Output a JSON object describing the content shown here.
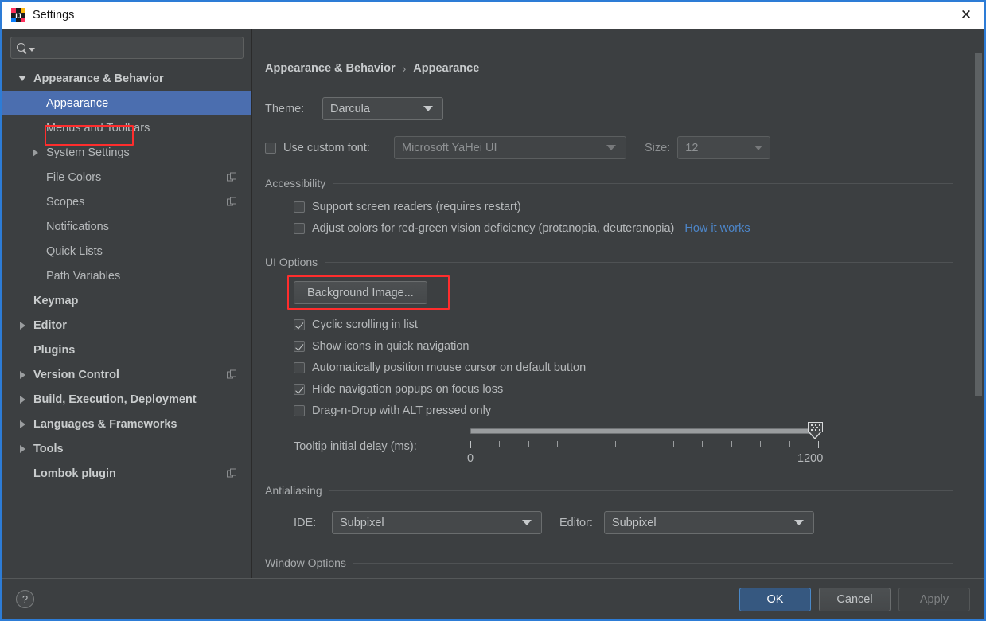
{
  "window": {
    "title": "Settings",
    "close_label": "✕",
    "accent_border": "#2d7cd6",
    "titlebar_bg": "#ffffff",
    "panel_bg": "#3c3f41",
    "selection_blue": "#4b6eaf",
    "link_blue": "#4d86c9",
    "annotation_red": "#ff2d2d"
  },
  "search": {
    "value": "",
    "placeholder": "",
    "icon": "search-icon",
    "dropdown_icon": "caret-down-icon"
  },
  "sidebar": {
    "items": [
      {
        "label": "Appearance & Behavior",
        "level": 0,
        "bold": true,
        "arrow": "down",
        "selected": false,
        "badge": false
      },
      {
        "label": "Appearance",
        "level": 1,
        "bold": false,
        "arrow": "none",
        "selected": true,
        "badge": false
      },
      {
        "label": "Menus and Toolbars",
        "level": 1,
        "bold": false,
        "arrow": "none",
        "selected": false,
        "badge": false
      },
      {
        "label": "System Settings",
        "level": 1,
        "bold": false,
        "arrow": "right",
        "selected": false,
        "badge": false
      },
      {
        "label": "File Colors",
        "level": 1,
        "bold": false,
        "arrow": "none",
        "selected": false,
        "badge": true
      },
      {
        "label": "Scopes",
        "level": 1,
        "bold": false,
        "arrow": "none",
        "selected": false,
        "badge": true
      },
      {
        "label": "Notifications",
        "level": 1,
        "bold": false,
        "arrow": "none",
        "selected": false,
        "badge": false
      },
      {
        "label": "Quick Lists",
        "level": 1,
        "bold": false,
        "arrow": "none",
        "selected": false,
        "badge": false
      },
      {
        "label": "Path Variables",
        "level": 1,
        "bold": false,
        "arrow": "none",
        "selected": false,
        "badge": false
      },
      {
        "label": "Keymap",
        "level": 0,
        "bold": true,
        "arrow": "none",
        "selected": false,
        "badge": false
      },
      {
        "label": "Editor",
        "level": 0,
        "bold": true,
        "arrow": "right",
        "selected": false,
        "badge": false
      },
      {
        "label": "Plugins",
        "level": 0,
        "bold": true,
        "arrow": "none",
        "selected": false,
        "badge": false
      },
      {
        "label": "Version Control",
        "level": 0,
        "bold": true,
        "arrow": "right",
        "selected": false,
        "badge": true
      },
      {
        "label": "Build, Execution, Deployment",
        "level": 0,
        "bold": true,
        "arrow": "right",
        "selected": false,
        "badge": false
      },
      {
        "label": "Languages & Frameworks",
        "level": 0,
        "bold": true,
        "arrow": "right",
        "selected": false,
        "badge": false
      },
      {
        "label": "Tools",
        "level": 0,
        "bold": true,
        "arrow": "right",
        "selected": false,
        "badge": false
      },
      {
        "label": "Lombok plugin",
        "level": 0,
        "bold": true,
        "arrow": "none",
        "selected": false,
        "badge": true
      }
    ]
  },
  "breadcrumb": {
    "parent": "Appearance & Behavior",
    "separator": "›",
    "current": "Appearance"
  },
  "theme": {
    "label": "Theme:",
    "value": "Darcula"
  },
  "custom_font": {
    "checkbox_label": "Use custom font:",
    "checked": false,
    "font_value": "Microsoft YaHei UI",
    "size_label": "Size:",
    "size_value": "12"
  },
  "accessibility": {
    "title": "Accessibility",
    "options": [
      {
        "label": "Support screen readers (requires restart)",
        "checked": false
      },
      {
        "label": "Adjust colors for red-green vision deficiency (protanopia, deuteranopia)",
        "checked": false
      }
    ],
    "link": "How it works"
  },
  "ui_options": {
    "title": "UI Options",
    "background_image_button": "Background Image...",
    "options": [
      {
        "label": "Cyclic scrolling in list",
        "checked": true
      },
      {
        "label": "Show icons in quick navigation",
        "checked": true
      },
      {
        "label": "Automatically position mouse cursor on default button",
        "checked": false
      },
      {
        "label": "Hide navigation popups on focus loss",
        "checked": true
      },
      {
        "label": "Drag-n-Drop with ALT pressed only",
        "checked": false
      }
    ],
    "slider": {
      "label": "Tooltip initial delay (ms):",
      "min_label": "0",
      "max_label": "1200",
      "min": 0,
      "max": 1200,
      "value": 1200,
      "tick_count": 13
    }
  },
  "antialiasing": {
    "title": "Antialiasing",
    "ide_label": "IDE:",
    "ide_value": "Subpixel",
    "editor_label": "Editor:",
    "editor_value": "Subpixel"
  },
  "window_options": {
    "title": "Window Options"
  },
  "footer": {
    "help_label": "?",
    "ok_label": "OK",
    "cancel_label": "Cancel",
    "apply_label": "Apply"
  }
}
